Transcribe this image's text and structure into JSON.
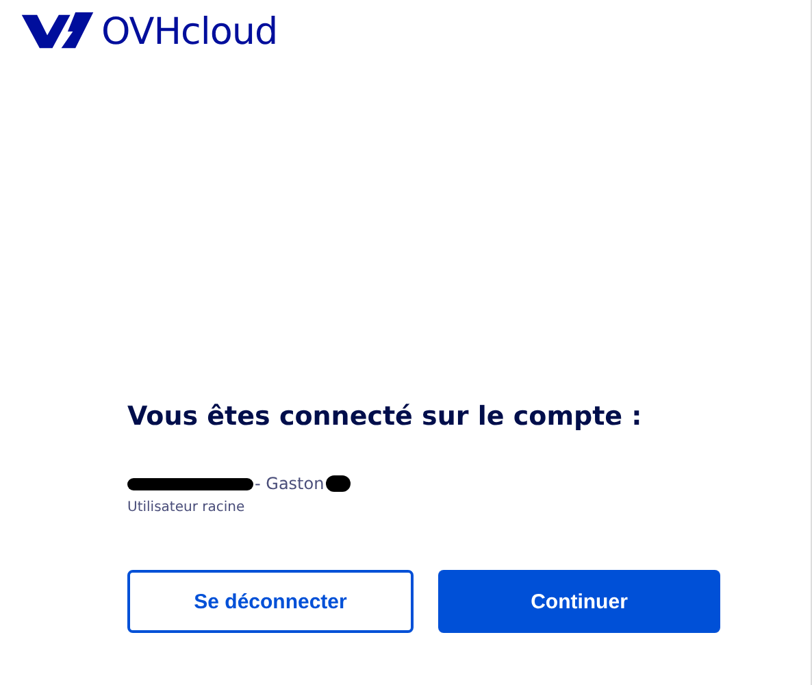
{
  "logo": {
    "text": "OVHcloud"
  },
  "heading": "Vous êtes connecté sur le compte :",
  "account": {
    "name": "- Gaston",
    "role": "Utilisateur racine"
  },
  "buttons": [
    {
      "label": "Se déconnecter",
      "kind": "secondary"
    },
    {
      "label": "Continuer",
      "kind": "primary"
    }
  ]
}
